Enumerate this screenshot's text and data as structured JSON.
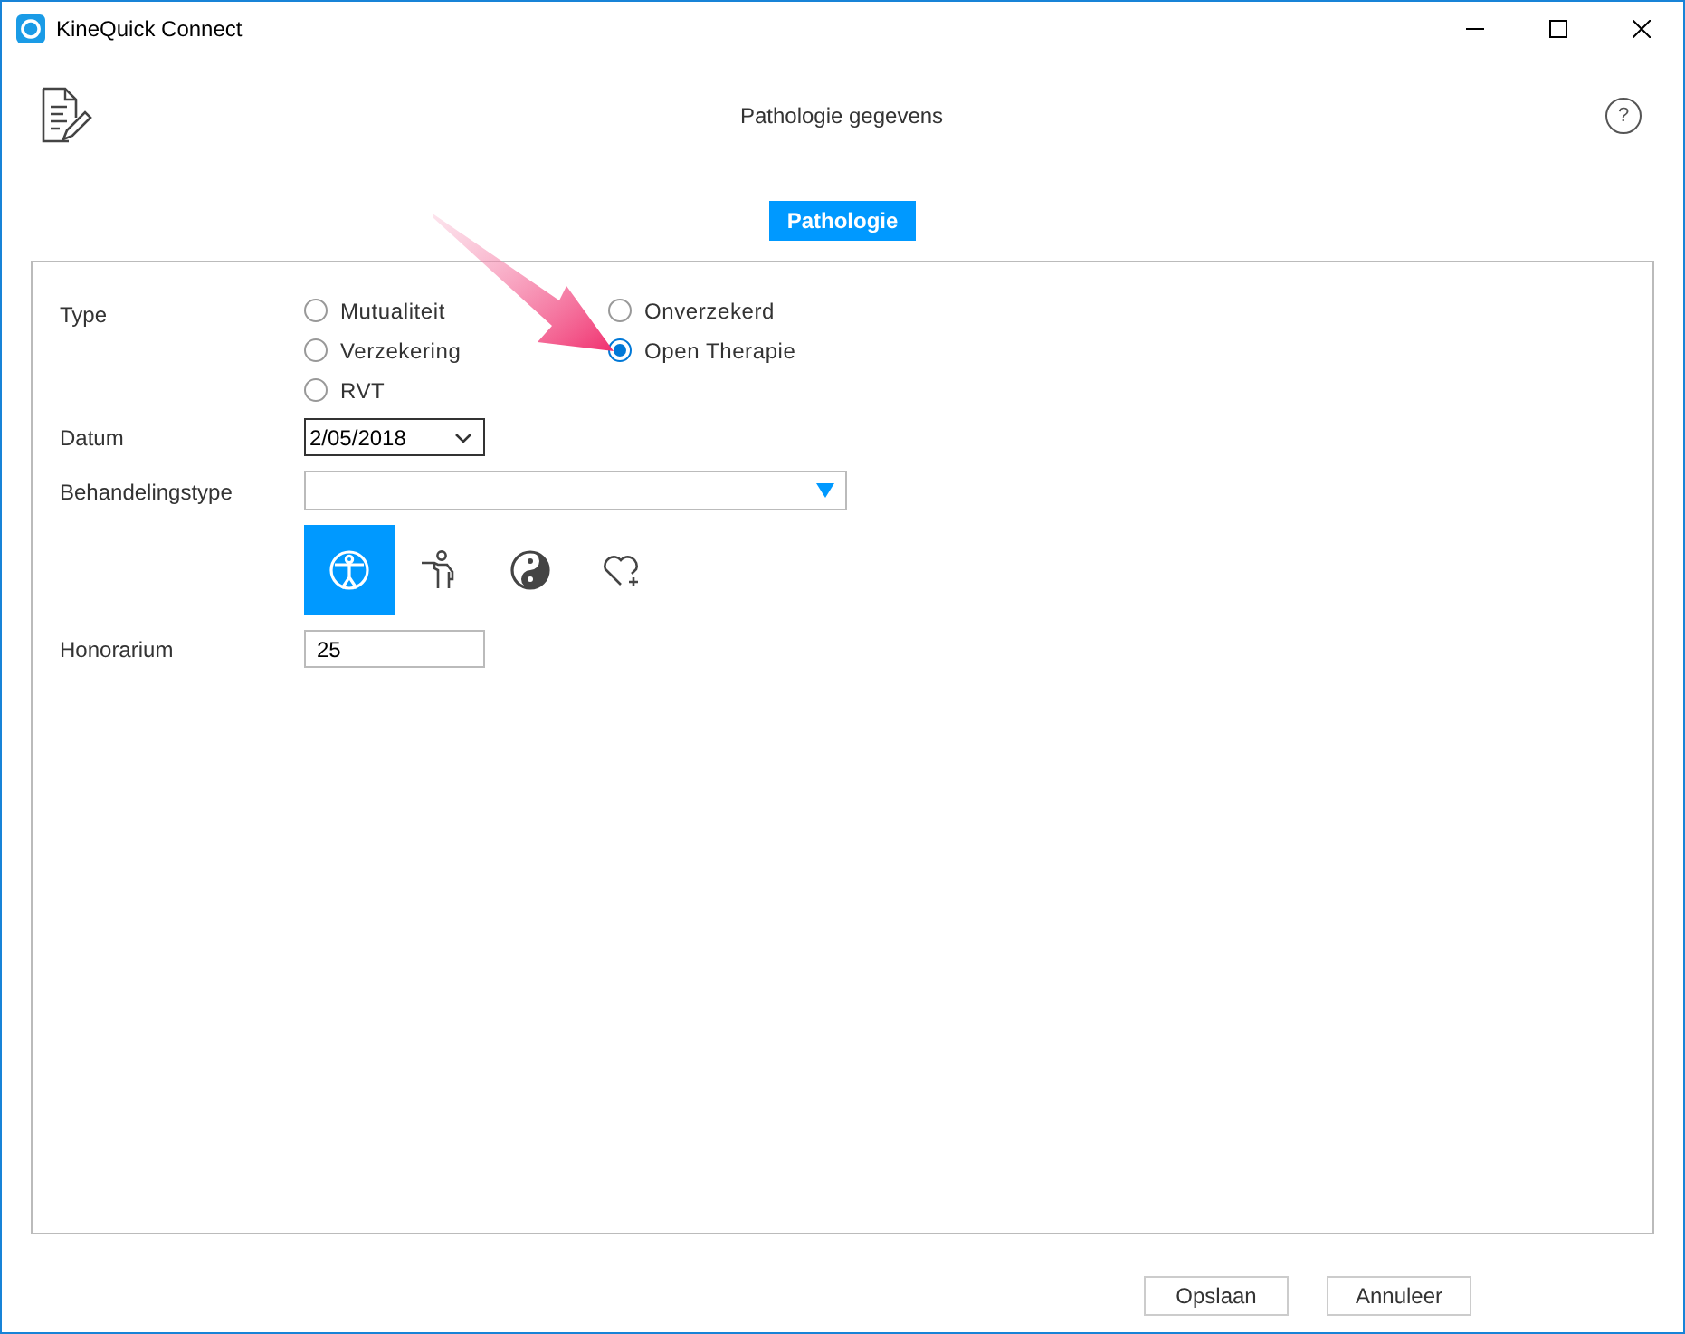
{
  "window": {
    "title": "KineQuick Connect"
  },
  "header": {
    "title": "Pathologie gegevens",
    "help": "?"
  },
  "tabs": [
    {
      "label": "Pathologie",
      "selected": true
    }
  ],
  "form": {
    "type": {
      "label": "Type",
      "options": [
        {
          "label": "Mutualiteit",
          "selected": false
        },
        {
          "label": "Onverzekerd",
          "selected": false
        },
        {
          "label": "Verzekering",
          "selected": false
        },
        {
          "label": "Open Therapie",
          "selected": true
        },
        {
          "label": "RVT",
          "selected": false
        }
      ]
    },
    "datum": {
      "label": "Datum",
      "value": "2/05/2018"
    },
    "behandelingstype": {
      "label": "Behandelingstype"
    },
    "treatments": [
      {
        "kind": "body",
        "selected": true
      },
      {
        "kind": "posture",
        "selected": false
      },
      {
        "kind": "yinyang",
        "selected": false
      },
      {
        "kind": "heart",
        "selected": false
      }
    ],
    "honorarium": {
      "label": "Honorarium",
      "value": "25"
    }
  },
  "buttons": [
    "Opslaan",
    "Annuleer"
  ]
}
